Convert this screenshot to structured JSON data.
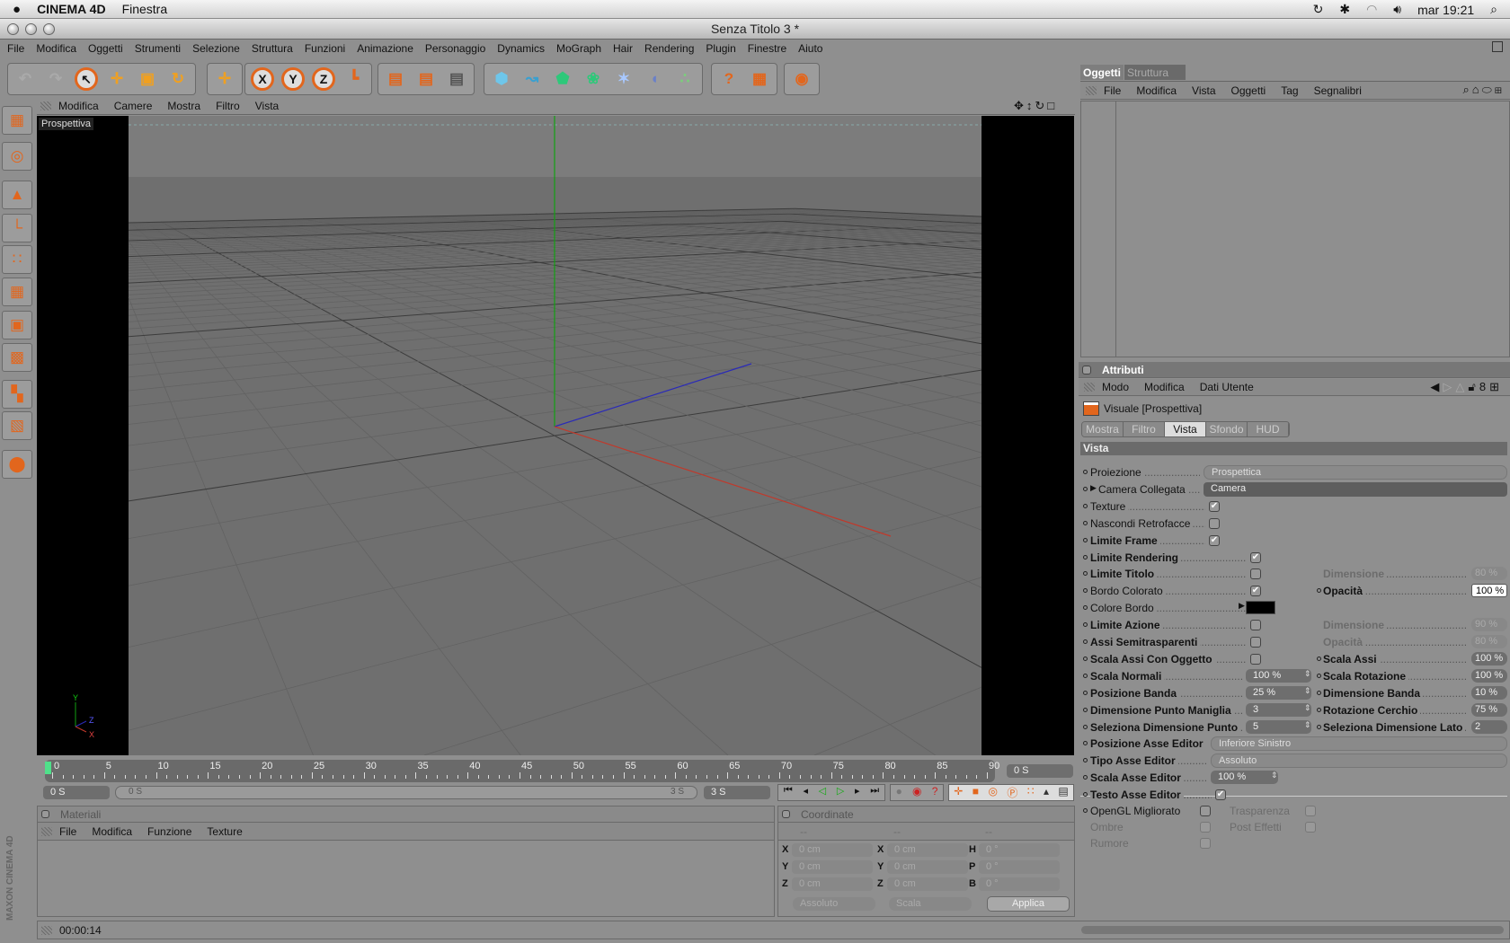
{
  "macos": {
    "app_name": "CINEMA 4D",
    "menu": [
      "Finestra"
    ],
    "clock": "mar 19:21",
    "status_icons": [
      "sync-icon",
      "bluetooth-icon",
      "wifi-icon",
      "volume-icon"
    ]
  },
  "window": {
    "title": "Senza Titolo 3 *"
  },
  "menubar": [
    "File",
    "Modifica",
    "Oggetti",
    "Strumenti",
    "Selezione",
    "Struttura",
    "Funzioni",
    "Animazione",
    "Personaggio",
    "Dynamics",
    "MoGraph",
    "Hair",
    "Rendering",
    "Plugin",
    "Finestre",
    "Aiuto"
  ],
  "toolbar": {
    "groups": [
      [
        "undo",
        "redo",
        "select",
        "move",
        "scale",
        "rotate"
      ],
      [
        "add-axis"
      ],
      [
        "x-axis",
        "y-axis",
        "z-axis",
        "coordinate-system"
      ],
      [
        "render-view",
        "render-picture-viewer",
        "render-settings"
      ],
      [
        "cube",
        "spline",
        "nurbs",
        "array",
        "deformer",
        "scene",
        "particles"
      ],
      [
        "help-pointer",
        "help-table"
      ],
      [
        "browser"
      ]
    ],
    "xyz": [
      "X",
      "Y",
      "Z"
    ]
  },
  "left_toolbar": [
    "layout",
    "model-tool",
    "object-axis",
    "axis",
    "points",
    "edges",
    "polygons",
    "uvw",
    "texture",
    "texture-axis",
    "sculpt"
  ],
  "viewport": {
    "menu": [
      "Modifica",
      "Camere",
      "Mostra",
      "Filtro",
      "Vista"
    ],
    "label": "Prospettiva",
    "axis_labels": [
      "Y",
      "Z",
      "X"
    ],
    "colors": {
      "x": "#c0392b",
      "y": "#12a012",
      "z": "#2a2ab8"
    }
  },
  "timeline": {
    "ticks": [
      "0",
      "5",
      "10",
      "15",
      "20",
      "25",
      "30",
      "35",
      "40",
      "45",
      "50",
      "55",
      "60",
      "65",
      "70",
      "75",
      "80",
      "85",
      "90"
    ],
    "current": "0 S",
    "start": "0 S",
    "range_start": "0 S",
    "range_end": "3 S",
    "end": "3 S"
  },
  "materials": {
    "title": "Materiali",
    "menu": [
      "File",
      "Modifica",
      "Funzione",
      "Texture"
    ]
  },
  "coordinates": {
    "title": "Coordinate",
    "columns": [
      "--",
      "--",
      "--"
    ],
    "rows": [
      {
        "a": "X",
        "av": "0 cm",
        "b": "X",
        "bv": "0 cm",
        "c": "H",
        "cv": "0 °"
      },
      {
        "a": "Y",
        "av": "0 cm",
        "b": "Y",
        "bv": "0 cm",
        "c": "P",
        "cv": "0 °"
      },
      {
        "a": "Z",
        "av": "0 cm",
        "b": "Z",
        "bv": "0 cm",
        "c": "B",
        "cv": "0 °"
      }
    ],
    "mode": "Assoluto",
    "size_mode": "Scala",
    "apply": "Applica"
  },
  "status": {
    "time": "00:00:14",
    "logo": "MAXON CINEMA 4D"
  },
  "objects": {
    "tabs": [
      "Oggetti",
      "Struttura"
    ],
    "active_tab": "Oggetti",
    "menu": [
      "File",
      "Modifica",
      "Vista",
      "Oggetti",
      "Tag",
      "Segnalibri"
    ]
  },
  "attributes": {
    "title": "Attributi",
    "menu": [
      "Modo",
      "Modifica",
      "Dati Utente"
    ],
    "object": "Visuale [Prospettiva]",
    "tabs": [
      "Mostra",
      "Filtro",
      "Vista",
      "Sfondo",
      "HUD"
    ],
    "active_tab": "Vista",
    "section": "Vista",
    "rows": [
      {
        "label": "Proiezione",
        "ctrl": "dropdown",
        "value": "Prospettica"
      },
      {
        "label": "Camera Collegata",
        "ctrl": "link",
        "value": "Camera"
      },
      {
        "label": "Texture",
        "ctrl": "check",
        "checked": true
      },
      {
        "label": "Nascondi Retrofacce",
        "ctrl": "check",
        "checked": false
      },
      {
        "label": "Limite Frame",
        "bold": true,
        "ctrl": "check",
        "checked": true
      },
      {
        "label": "Limite Rendering",
        "bold": true,
        "ctrl": "check2",
        "checked": true
      },
      {
        "label": "Limite Titolo",
        "bold": true,
        "ctrl": "check2",
        "checked": false,
        "right": {
          "label": "Dimensione",
          "value": "80 %",
          "dim": true
        }
      },
      {
        "label": "Bordo Colorato",
        "ctrl": "check2",
        "checked": true,
        "right": {
          "label": "Opacità",
          "value": "100 %",
          "active": true
        }
      },
      {
        "label": "Colore Bordo",
        "ctrl": "color",
        "value": "#000000"
      },
      {
        "label": "Limite Azione",
        "bold": true,
        "ctrl": "check2",
        "checked": false,
        "right": {
          "label": "Dimensione",
          "value": "90 %",
          "dim": true
        }
      },
      {
        "label": "Assi Semitrasparenti",
        "bold": true,
        "ctrl": "check2",
        "checked": false,
        "right": {
          "label": "Opacità",
          "value": "80 %",
          "dim": true
        }
      },
      {
        "label": "Scala Assi Con Oggetto",
        "bold": true,
        "ctrl": "check2",
        "checked": false,
        "right": {
          "label": "Scala Assi",
          "value": "100 %"
        }
      },
      {
        "label": "Scala Normali",
        "bold": true,
        "ctrl": "field",
        "value": "100 %",
        "right": {
          "label": "Scala Rotazione",
          "value": "100 %"
        }
      },
      {
        "label": "Posizione Banda",
        "bold": true,
        "ctrl": "field",
        "value": "25 %",
        "right": {
          "label": "Dimensione Banda",
          "value": "10 %"
        }
      },
      {
        "label": "Dimensione Punto Maniglia",
        "bold": true,
        "ctrl": "field",
        "value": "3",
        "right": {
          "label": "Rotazione Cerchio",
          "value": "75 %"
        }
      },
      {
        "label": "Seleziona Dimensione Punto",
        "bold": true,
        "ctrl": "field",
        "value": "5",
        "right": {
          "label": "Seleziona Dimensione Lato",
          "value": "2"
        }
      },
      {
        "label": "Posizione Asse Editor",
        "bold": true,
        "ctrl": "dropdown2",
        "value": "Inferiore Sinistro"
      },
      {
        "label": "Tipo Asse Editor",
        "bold": true,
        "ctrl": "dropdown2",
        "value": "Assoluto"
      },
      {
        "label": "Scala Asse Editor",
        "bold": true,
        "ctrl": "field2",
        "value": "100 %"
      },
      {
        "label": "Testo Asse Editor",
        "bold": true,
        "ctrl": "check3",
        "checked": true
      }
    ],
    "extra": [
      {
        "label": "OpenGL Migliorato",
        "checked": false,
        "right": "Trasparenza"
      },
      {
        "label": "Ombre",
        "checked": false,
        "dim": true,
        "right": "Post Effetti"
      },
      {
        "label": "Rumore",
        "checked": false,
        "dim": true
      }
    ]
  }
}
